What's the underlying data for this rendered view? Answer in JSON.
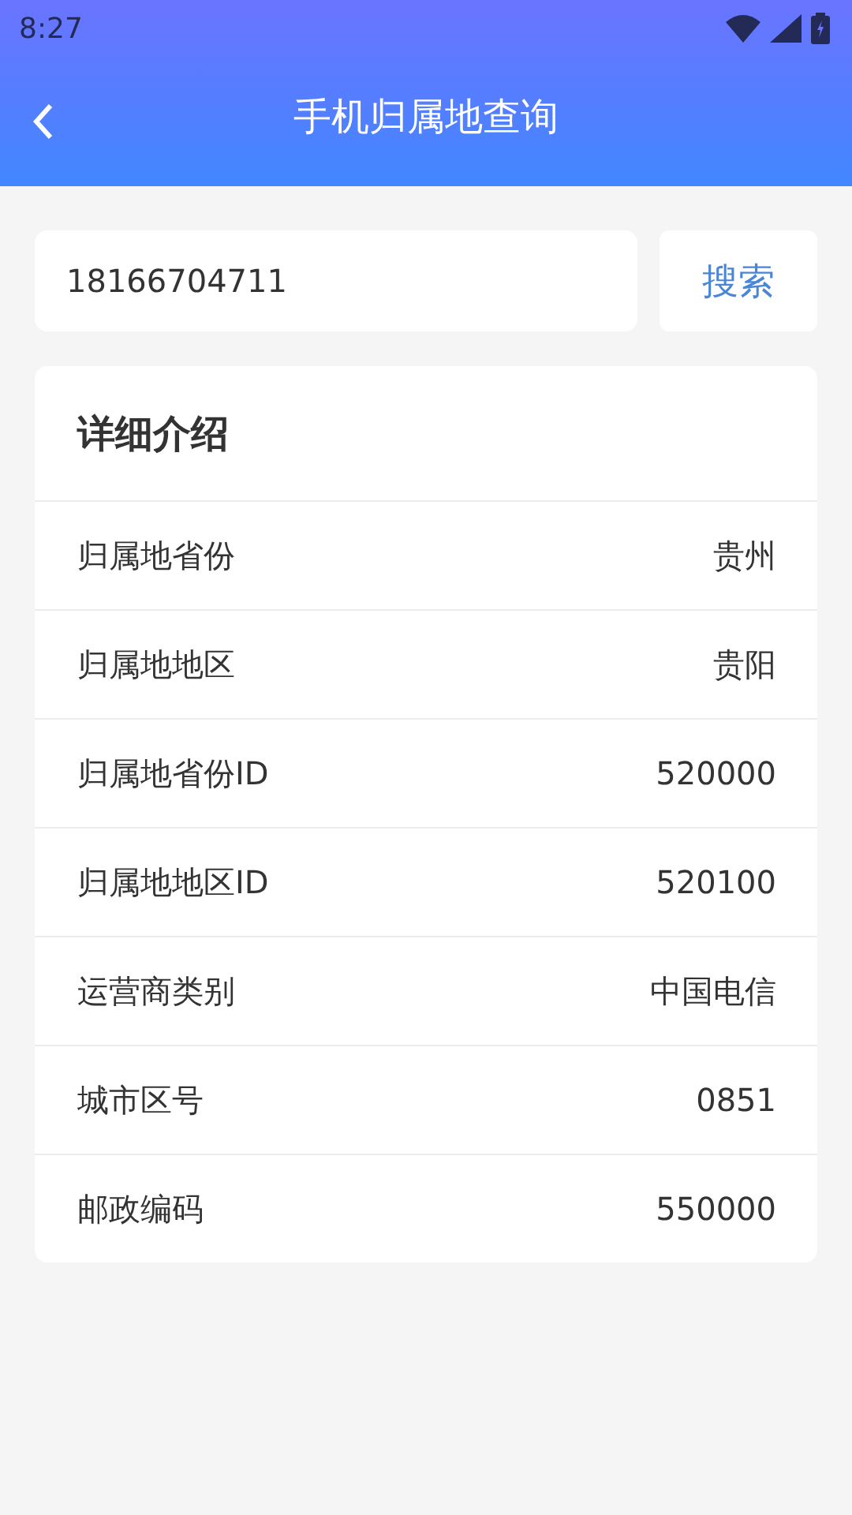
{
  "status_bar": {
    "time": "8:27"
  },
  "header": {
    "title": "手机归属地查询"
  },
  "search": {
    "value": "18166704711",
    "button": "搜索"
  },
  "details": {
    "title": "详细介绍",
    "rows": [
      {
        "label": "归属地省份",
        "value": "贵州"
      },
      {
        "label": "归属地地区",
        "value": "贵阳"
      },
      {
        "label": "归属地省份ID",
        "value": "520000"
      },
      {
        "label": "归属地地区ID",
        "value": "520100"
      },
      {
        "label": "运营商类别",
        "value": "中国电信"
      },
      {
        "label": "城市区号",
        "value": "0851"
      },
      {
        "label": "邮政编码",
        "value": "550000"
      }
    ]
  }
}
